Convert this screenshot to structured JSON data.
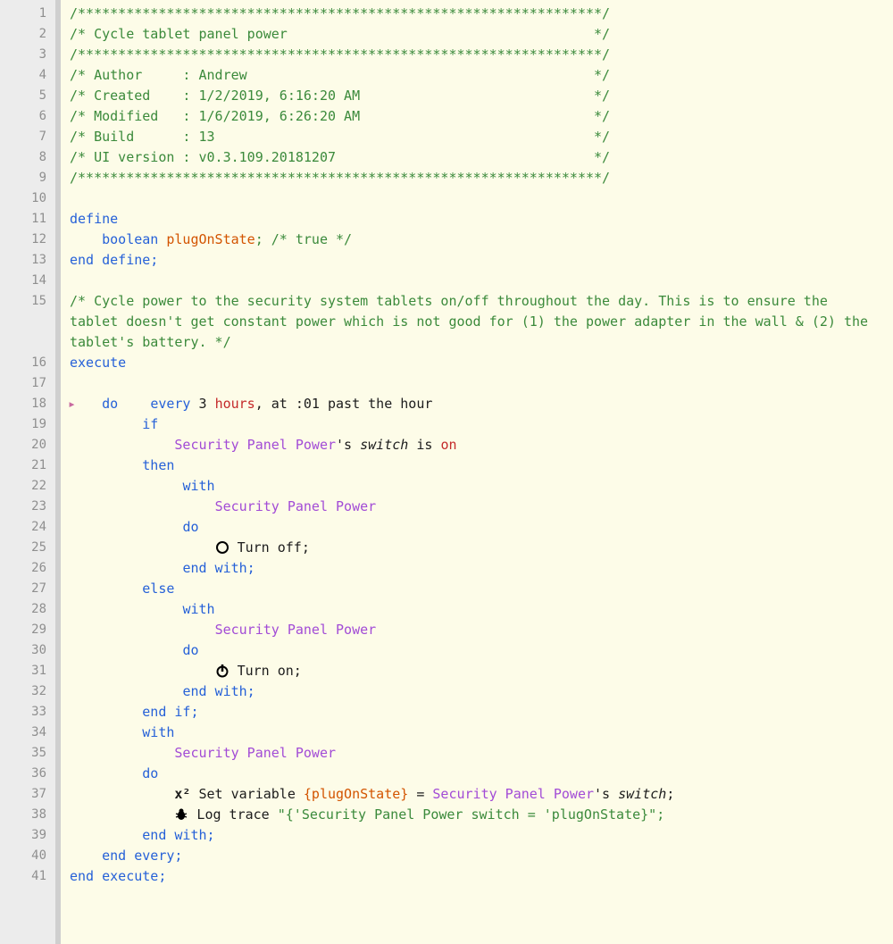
{
  "header": {
    "stars_top": "/*****************************************************************/",
    "title": "/* Cycle tablet panel power                                      */",
    "author": "/* Author     : Andrew                                           */",
    "created": "/* Created    : 1/2/2019, 6:16:20 AM                             */",
    "modified": "/* Modified   : 1/6/2019, 6:26:20 AM                             */",
    "build": "/* Build      : 13                                               */",
    "uiver": "/* UI version : v0.3.109.20181207                                */",
    "stars_bot": "/*****************************************************************/"
  },
  "decls": {
    "define": "define",
    "boolean": "boolean",
    "varname": "plugOnState",
    "true_comment": "; /* true */",
    "end_define": "end define;"
  },
  "big_comment": "/* Cycle power to the security system tablets on/off throughout the day. This is to ensure the tablet doesn't get constant power which is not good for (1) the power adapter in the wall & (2) the tablet's battery. */",
  "exec": {
    "execute": "execute",
    "every": "every",
    "three": "3",
    "hours": "hours",
    "at_part": ", at :01 past the hour",
    "do": "do",
    "if": "if",
    "device": "Security Panel Power",
    "poss": "'s ",
    "switch": "switch",
    "is": " is ",
    "on": "on",
    "then": "then",
    "with": "with",
    "turn_off": " Turn off;",
    "end_with": "end with;",
    "else": "else",
    "turn_on": " Turn on;",
    "end_if": "end if;",
    "assign": " Set variable ",
    "plugVarBraced": "{plugOnState}",
    "equals": " = ",
    "semicolon": ";",
    "log_cmd": " Log trace ",
    "log_string": "\"{'Security Panel Power switch = 'plugOnState}\";",
    "end_every": "end every;",
    "end_execute": "end execute;"
  },
  "bookmark": "▸"
}
